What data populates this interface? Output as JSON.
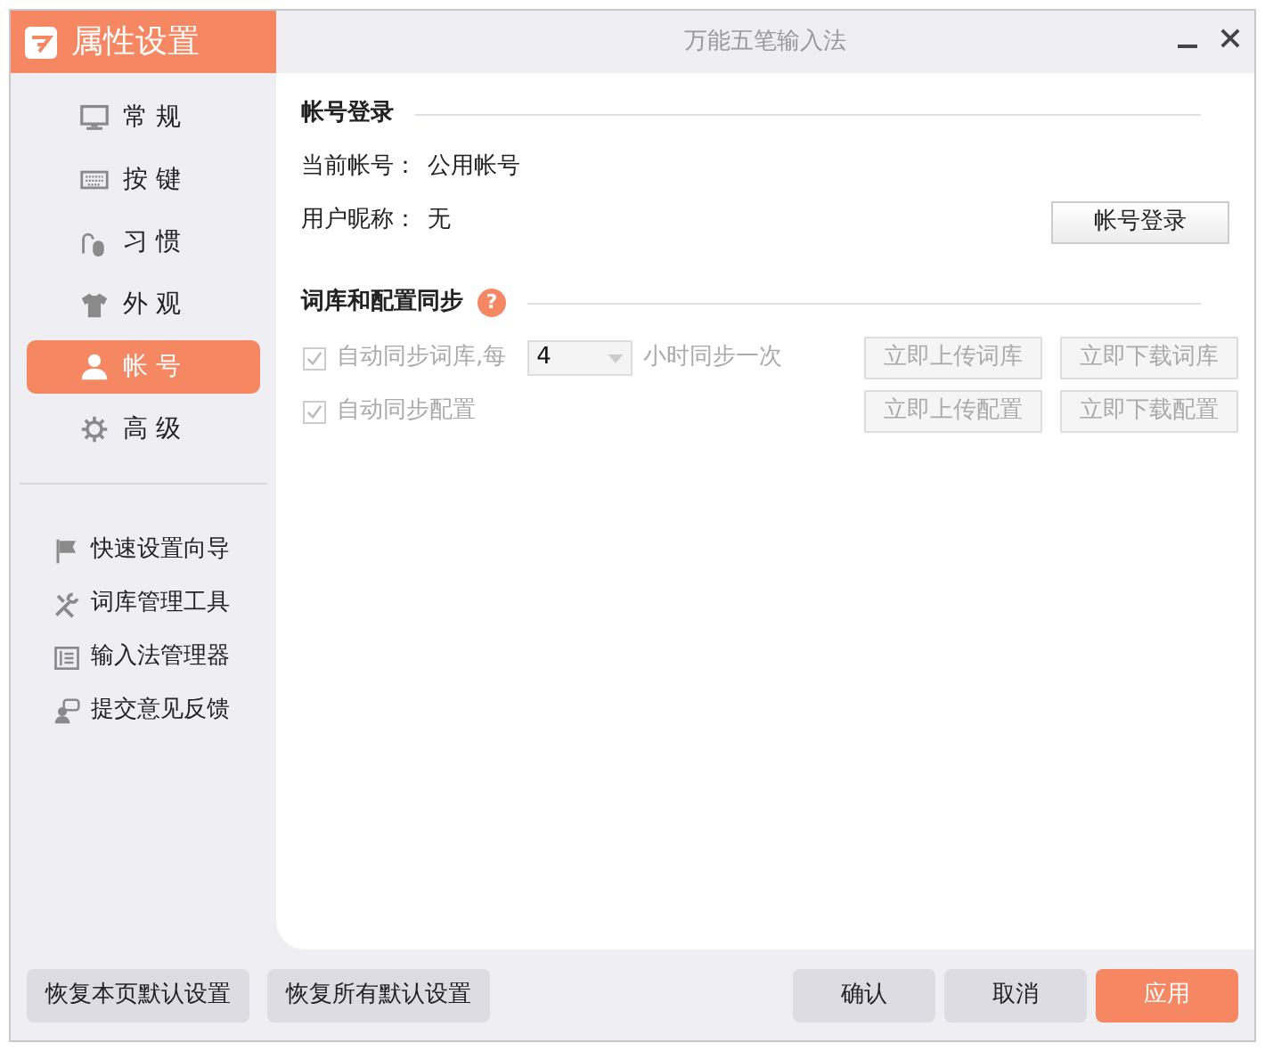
{
  "app_header": {
    "title": "属性设置"
  },
  "window": {
    "title": "万能五笔输入法"
  },
  "nav": [
    {
      "kind": "monitor",
      "label": "常 规",
      "selected": false
    },
    {
      "kind": "keyboard",
      "label": "按 键",
      "selected": false
    },
    {
      "kind": "mouse",
      "label": "习 惯",
      "selected": false
    },
    {
      "kind": "shirt",
      "label": "外 观",
      "selected": false
    },
    {
      "kind": "user",
      "label": "帐 号",
      "selected": true
    },
    {
      "kind": "gear",
      "label": "高 级",
      "selected": false
    }
  ],
  "tools": [
    {
      "kind": "flag",
      "label": "快速设置向导"
    },
    {
      "kind": "tools",
      "label": "词库管理工具"
    },
    {
      "kind": "list",
      "label": "输入法管理器"
    },
    {
      "kind": "feedback",
      "label": "提交意见反馈"
    }
  ],
  "account_section": {
    "heading": "帐号登录",
    "fields": [
      {
        "label": "当前帐号：",
        "value": "公用帐号"
      },
      {
        "label": "用户昵称：",
        "value": "无"
      }
    ],
    "login_button": "帐号登录"
  },
  "sync_section": {
    "heading": "词库和配置同步",
    "help_icon": "?",
    "auto_sync_dict": {
      "label": "自动同步词库,每",
      "checked": true,
      "disabled": true,
      "interval": "4",
      "suffix": "小时同步一次"
    },
    "auto_sync_config": {
      "label": "自动同步配置",
      "checked": true,
      "disabled": true
    },
    "buttons": [
      {
        "label": "立即上传词库",
        "disabled": true
      },
      {
        "label": "立即下载词库",
        "disabled": true
      },
      {
        "label": "立即上传配置",
        "disabled": true
      },
      {
        "label": "立即下载配置",
        "disabled": true
      }
    ]
  },
  "footer": {
    "left": [
      {
        "label": "恢复本页默认设置",
        "kind": "normal"
      },
      {
        "label": "恢复所有默认设置",
        "kind": "normal"
      }
    ],
    "right": [
      {
        "label": "确认",
        "kind": "normal"
      },
      {
        "label": "取消",
        "kind": "normal"
      },
      {
        "label": "应用",
        "kind": "primary"
      }
    ]
  }
}
